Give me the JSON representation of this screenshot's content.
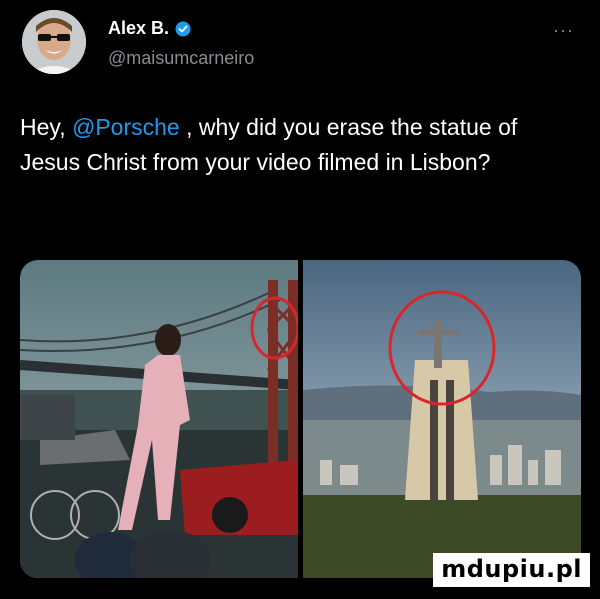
{
  "author": {
    "name": "Alex B.",
    "handle": "@maisumcarneiro",
    "verified_color": "#1d9bf0",
    "more_label": "···"
  },
  "tweet": {
    "prefix": "Hey, ",
    "mention": "@Porsche",
    "suffix": " , why did you erase the statue of Jesus Christ from your video filmed in Lisbon?"
  },
  "media": {
    "left_image": "porsche-ad-bridge-scene",
    "right_image": "cristo-rei-statue-lisbon",
    "circle_color": "#d8262b"
  },
  "watermark": "mdupiu.pl"
}
